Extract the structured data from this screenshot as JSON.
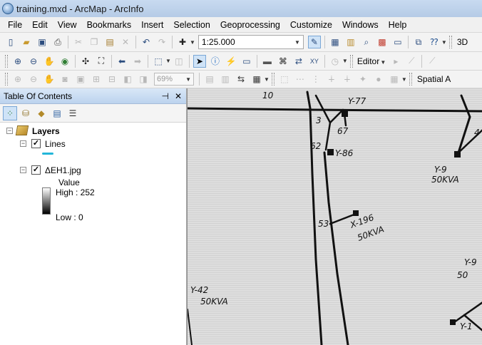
{
  "window": {
    "title": "training.mxd - ArcMap - ArcInfo"
  },
  "menu": [
    "File",
    "Edit",
    "View",
    "Bookmarks",
    "Insert",
    "Selection",
    "Geoprocessing",
    "Customize",
    "Windows",
    "Help"
  ],
  "toolbar": {
    "scale_value": "1:25.000",
    "zoom_value": "69%",
    "editor_label": "Editor",
    "spatial_label": "Spatial A",
    "three_d_label": "3D"
  },
  "toc": {
    "title": "Table Of Contents",
    "root": {
      "label": "Layers"
    },
    "layers": [
      {
        "name": "Lines",
        "checked": true
      },
      {
        "name": "ΔΕΗ1.jpg",
        "checked": true,
        "legend_title": "Value",
        "high": "High : 252",
        "low": "Low : 0"
      }
    ]
  },
  "map": {
    "annotations": [
      "10",
      "Y-77",
      "3",
      "67",
      "62",
      "Y-86",
      "53",
      "X-196",
      "50KVA",
      "Y-9",
      "50KVA",
      "Y-42",
      "50KVA",
      "4",
      "Y-9",
      "50",
      "Y-1"
    ]
  }
}
